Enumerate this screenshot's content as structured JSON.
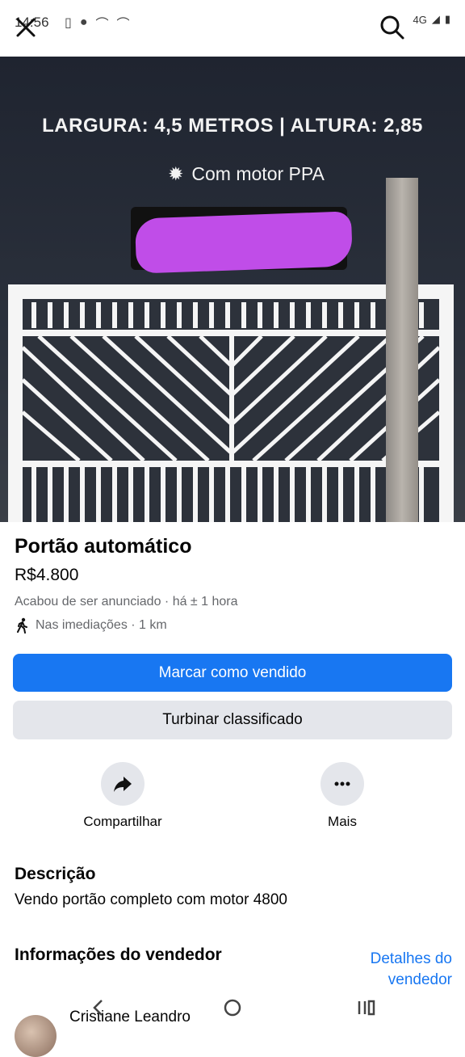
{
  "status": {
    "time": "14:56",
    "network": "4G"
  },
  "hero": {
    "line1": "LARGURA: 4,5 METROS | ALTURA: 2,85",
    "line2": "Com motor PPA"
  },
  "listing": {
    "title": "Portão automático",
    "price": "R$4.800",
    "posted": "Acabou de ser anunciado  · há ± 1 hora",
    "location": "Nas imediações · 1 km"
  },
  "buttons": {
    "mark_sold": "Marcar como vendido",
    "boost": "Turbinar classificado"
  },
  "actions": {
    "share": "Compartilhar",
    "more": "Mais"
  },
  "description": {
    "heading": "Descrição",
    "text": "Vendo portão completo com motor 4800"
  },
  "seller": {
    "heading": "Informações do vendedor",
    "details_link": "Detalhes do vendedor",
    "name": "Cristiane Leandro"
  },
  "colors": {
    "primary": "#1877f2",
    "secondary_bg": "#e4e6eb",
    "muted_text": "#65676b"
  }
}
